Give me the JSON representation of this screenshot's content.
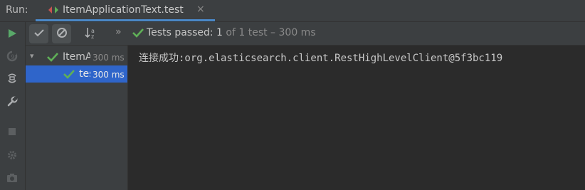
{
  "header": {
    "run_label": "Run:",
    "tab": {
      "title": "ItemApplicationText.test",
      "close": "×",
      "icon": "run-config-icon"
    }
  },
  "left_toolbar": {
    "items": [
      {
        "icon": "play-icon",
        "enabled": true
      },
      {
        "icon": "rerun-failed-icon",
        "enabled": false
      },
      {
        "icon": "restore-layout-icon",
        "enabled": true
      },
      {
        "icon": "wrench-icon",
        "enabled": true
      },
      {
        "icon": "stop-icon",
        "enabled": false
      },
      {
        "icon": "settings-icon",
        "enabled": false
      },
      {
        "icon": "camera-icon",
        "enabled": false
      }
    ]
  },
  "test_toolbar": {
    "show_passed": {
      "icon": "check-icon",
      "active": true
    },
    "show_ignored": {
      "icon": "cancel-icon",
      "active": true
    },
    "sort": {
      "icon": "sort-alpha-icon"
    },
    "more": "»",
    "status": {
      "prefix": "Tests passed:",
      "count": "1",
      "suffix": "of 1 test – 300 ms"
    }
  },
  "test_tree": {
    "rows": [
      {
        "name": "ItemApplicationText",
        "duration": "300 ms",
        "status": "passed",
        "expanded": true,
        "selected": false
      },
      {
        "name": "test",
        "duration": "300 ms",
        "status": "passed",
        "selected": true
      }
    ]
  },
  "console": {
    "lines": [
      "连接成功:org.elasticsearch.client.RestHighLevelClient@5f3bc119"
    ]
  },
  "colors": {
    "accent": "#4a88c7",
    "selection": "#2f65ca",
    "passed": "#5fb057"
  }
}
